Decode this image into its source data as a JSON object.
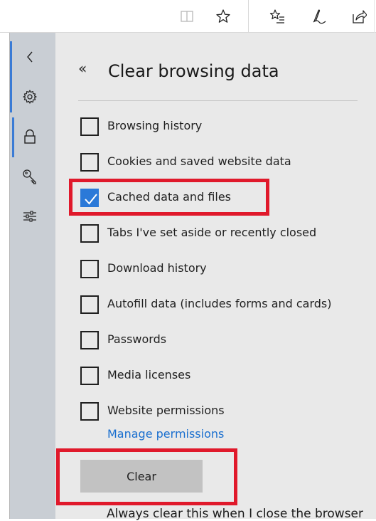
{
  "toolbar": {
    "icons": [
      "reading-view-icon",
      "favorite-star-icon",
      "favorites-hub-icon",
      "web-note-icon",
      "share-icon"
    ]
  },
  "rail": {
    "items": [
      "collapse-icon",
      "settings-icon",
      "privacy-lock-icon",
      "passwords-key-icon",
      "advanced-sliders-icon"
    ],
    "active": "privacy-lock-icon"
  },
  "panel": {
    "back_glyph": "«",
    "title": "Clear browsing data",
    "options": [
      {
        "label": "Browsing history",
        "checked": false
      },
      {
        "label": "Cookies and saved website data",
        "checked": false
      },
      {
        "label": "Cached data and files",
        "checked": true
      },
      {
        "label": "Tabs I've set aside or recently closed",
        "checked": false
      },
      {
        "label": "Download history",
        "checked": false
      },
      {
        "label": "Autofill data (includes forms and cards)",
        "checked": false
      },
      {
        "label": "Passwords",
        "checked": false
      },
      {
        "label": "Media licenses",
        "checked": false
      },
      {
        "label": "Website permissions",
        "checked": false
      }
    ],
    "manage_link": "Manage permissions",
    "clear_button": "Clear",
    "always_clear_text": "Always clear this when I close the browser"
  },
  "colors": {
    "accent": "#2b79d8",
    "highlight": "#e0192b",
    "link": "#1a6fcf",
    "panel_bg": "#e9e9e9",
    "rail_bg": "#c9ced4"
  }
}
